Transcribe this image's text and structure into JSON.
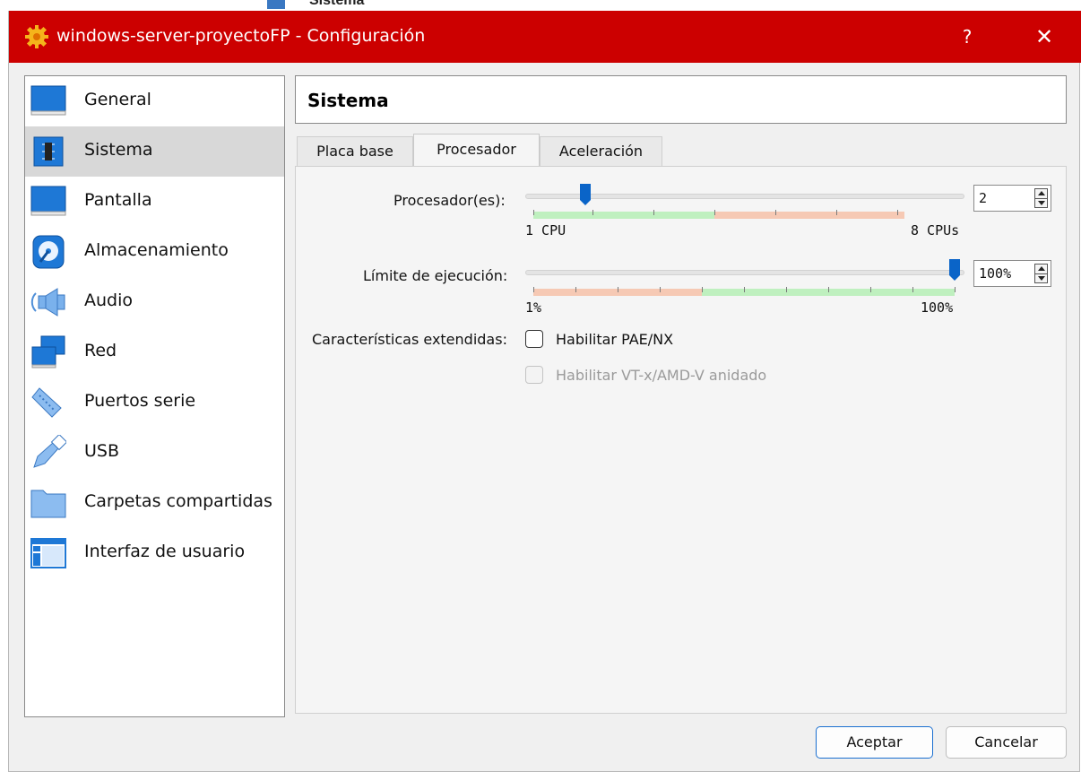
{
  "background_window": {
    "label": "Sistema"
  },
  "window": {
    "title": "windows-server-proyectoFP - Configuración",
    "help_glyph": "?",
    "close_glyph": "✕",
    "titlebar_color": "#cc0000"
  },
  "sidebar": {
    "items": [
      {
        "label": "General",
        "icon": "monitor-icon",
        "selected": false
      },
      {
        "label": "Sistema",
        "icon": "chip-icon",
        "selected": true
      },
      {
        "label": "Pantalla",
        "icon": "display-icon",
        "selected": false
      },
      {
        "label": "Almacenamiento",
        "icon": "disk-icon",
        "selected": false
      },
      {
        "label": "Audio",
        "icon": "speaker-icon",
        "selected": false
      },
      {
        "label": "Red",
        "icon": "network-icon",
        "selected": false
      },
      {
        "label": "Puertos serie",
        "icon": "serial-port-icon",
        "selected": false
      },
      {
        "label": "USB",
        "icon": "usb-icon",
        "selected": false
      },
      {
        "label": "Carpetas compartidas",
        "icon": "folder-icon",
        "selected": false
      },
      {
        "label": "Interfaz de usuario",
        "icon": "ui-window-icon",
        "selected": false
      }
    ]
  },
  "page": {
    "title": "Sistema",
    "tabs": [
      {
        "label": "Placa base",
        "active": false
      },
      {
        "label": "Procesador",
        "active": true
      },
      {
        "label": "Aceleración",
        "active": false
      }
    ]
  },
  "processor": {
    "processors_label": "Procesador(es):",
    "processors_value": "2",
    "processors_min_label": "1 CPU",
    "processors_max_label": "8 CPUs",
    "processors_min": 1,
    "processors_max": 8,
    "processors_current": 2,
    "cap_label": "Límite de ejecución:",
    "cap_value": "100%",
    "cap_min_label": "1%",
    "cap_max_label": "100%",
    "cap_current": 100,
    "extended_label": "Características extendidas:",
    "pae_label": "Habilitar PAE/NX",
    "pae_checked": false,
    "vtx_label": "Habilitar VT-x/AMD-V anidado",
    "vtx_checked": false,
    "vtx_enabled": false
  },
  "buttons": {
    "ok": "Aceptar",
    "cancel": "Cancelar"
  },
  "colors": {
    "accent": "#0a64c8",
    "good_zone": "#bff0bf",
    "warn_zone": "#f6c9b4"
  }
}
